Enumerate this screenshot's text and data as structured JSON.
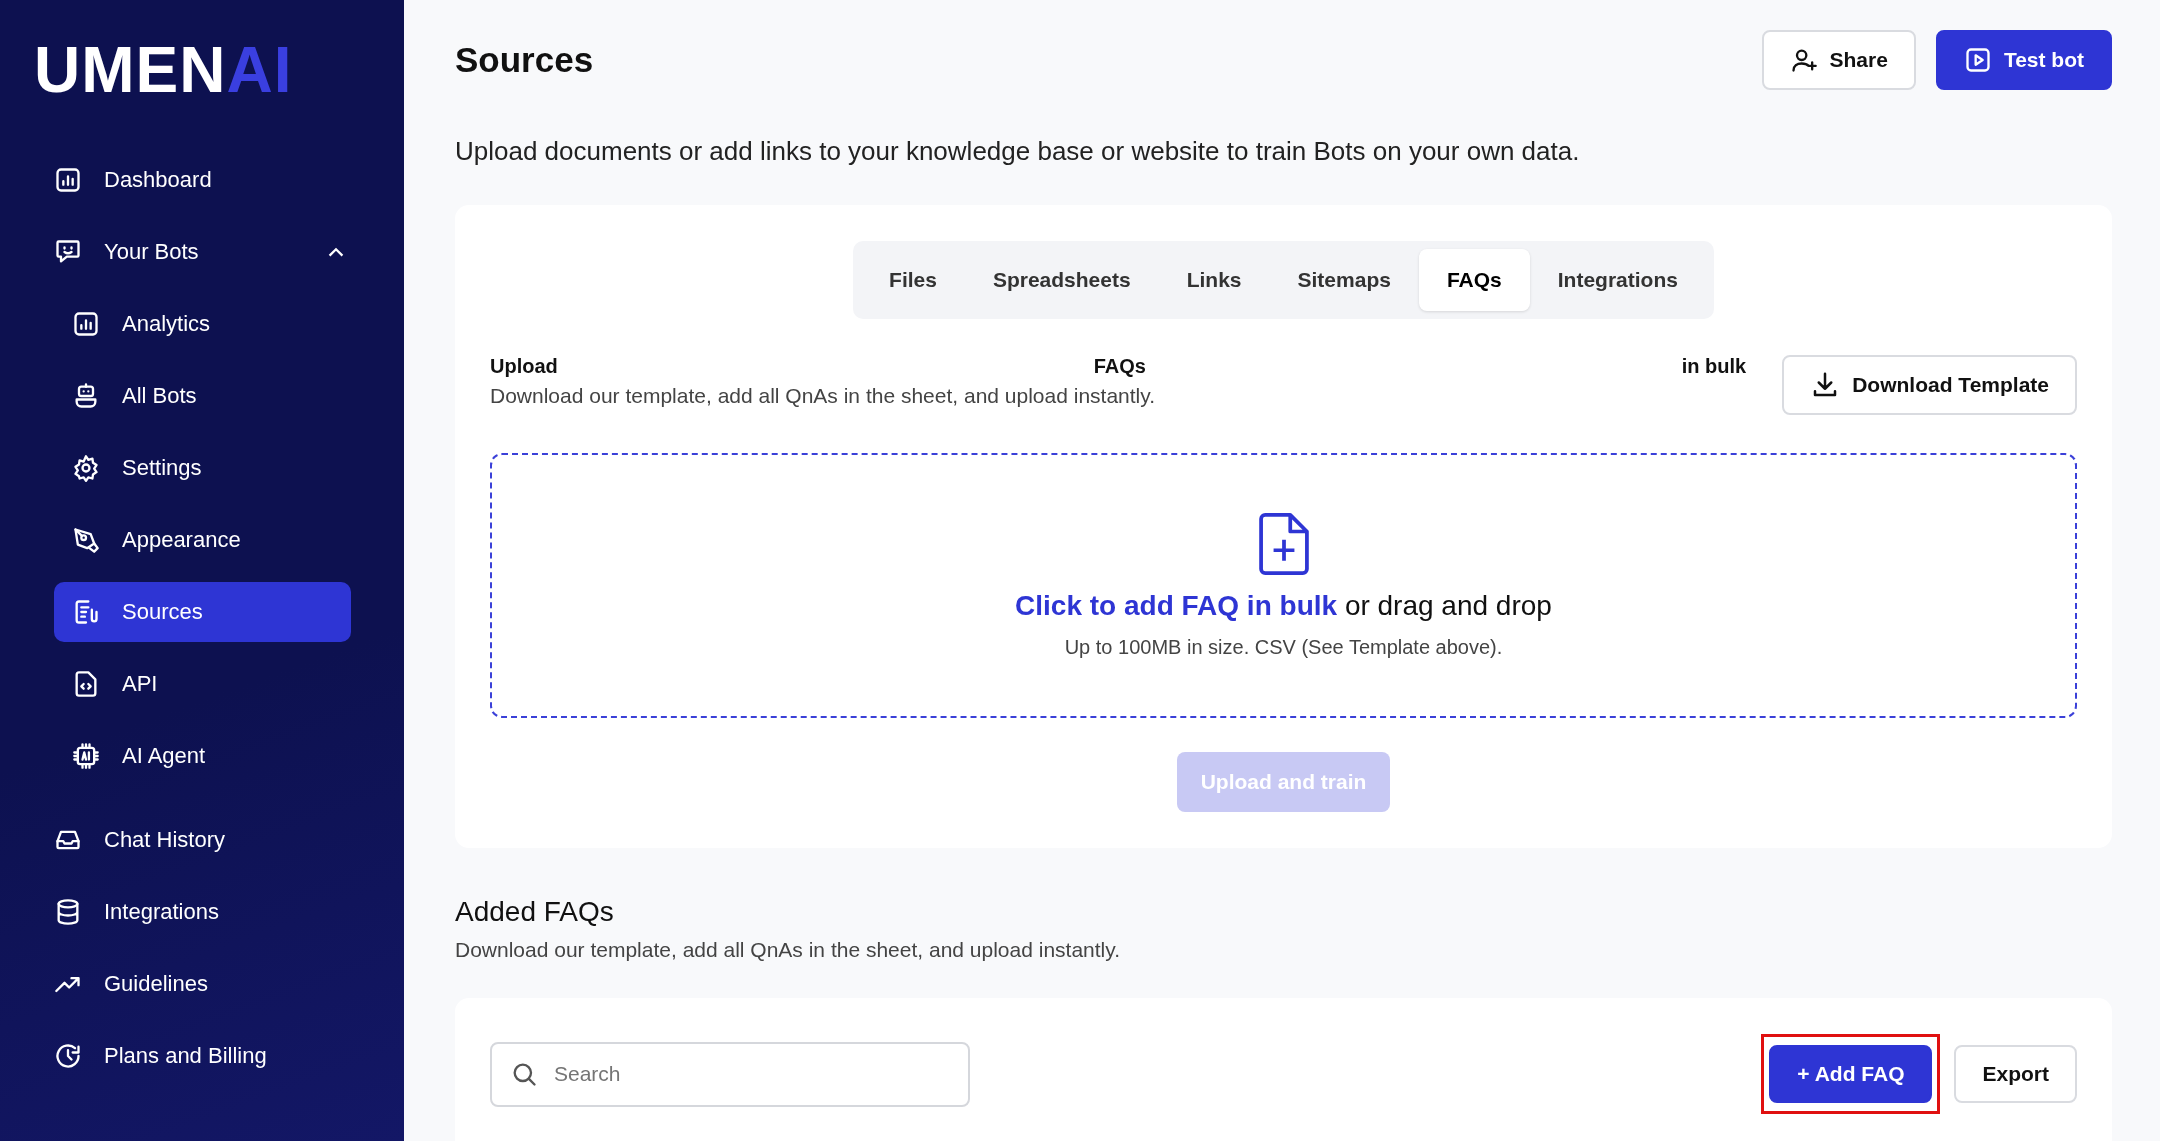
{
  "sidebar": {
    "logo": {
      "main": "UMEN",
      "accent": "AI"
    },
    "items": [
      {
        "label": "Dashboard",
        "selected": false
      },
      {
        "label": "Your Bots",
        "selected": false,
        "expanded": true,
        "children": [
          {
            "label": "Analytics",
            "selected": false
          },
          {
            "label": "All Bots",
            "selected": false
          },
          {
            "label": "Settings",
            "selected": false
          },
          {
            "label": "Appearance",
            "selected": false
          },
          {
            "label": "Sources",
            "selected": true
          },
          {
            "label": "API",
            "selected": false
          },
          {
            "label": "AI Agent",
            "selected": false
          }
        ]
      },
      {
        "label": "Chat History",
        "selected": false
      },
      {
        "label": "Integrations",
        "selected": false
      },
      {
        "label": "Guidelines",
        "selected": false
      },
      {
        "label": "Plans and Billing",
        "selected": false
      }
    ]
  },
  "header": {
    "title": "Sources",
    "buttons": [
      {
        "label": "Share",
        "kind": "outline"
      },
      {
        "label": "Test bot",
        "kind": "primary"
      }
    ],
    "description": "Upload documents or add links to your knowledge base or website to train Bots on your own data."
  },
  "tabs": [
    {
      "label": "Files",
      "selected": false
    },
    {
      "label": "Spreadsheets",
      "selected": false
    },
    {
      "label": "Links",
      "selected": false
    },
    {
      "label": "Sitemaps",
      "selected": false
    },
    {
      "label": "FAQs",
      "selected": true
    },
    {
      "label": "Integrations",
      "selected": false
    }
  ],
  "upload": {
    "heading": [
      "Upload",
      "FAQs",
      "in bulk"
    ],
    "description": "Download our template, add all QnAs in the sheet, and upload instantly.",
    "download_button": "Download Template",
    "dropzone": {
      "link": "Click to add FAQ in bulk",
      "text": "or drag and drop",
      "hint": "Up to 100MB in size. CSV (See Template above)."
    },
    "submit": {
      "label": "Upload and train",
      "disabled": true
    }
  },
  "added": {
    "title": "Added FAQs",
    "description": "Download our template, add all QnAs in the sheet, and upload instantly.",
    "search": {
      "placeholder": "Search"
    },
    "buttons": [
      {
        "label": "+ Add FAQ",
        "kind": "primary",
        "highlighted": true
      },
      {
        "label": "Export",
        "kind": "outline",
        "highlighted": false
      }
    ]
  }
}
